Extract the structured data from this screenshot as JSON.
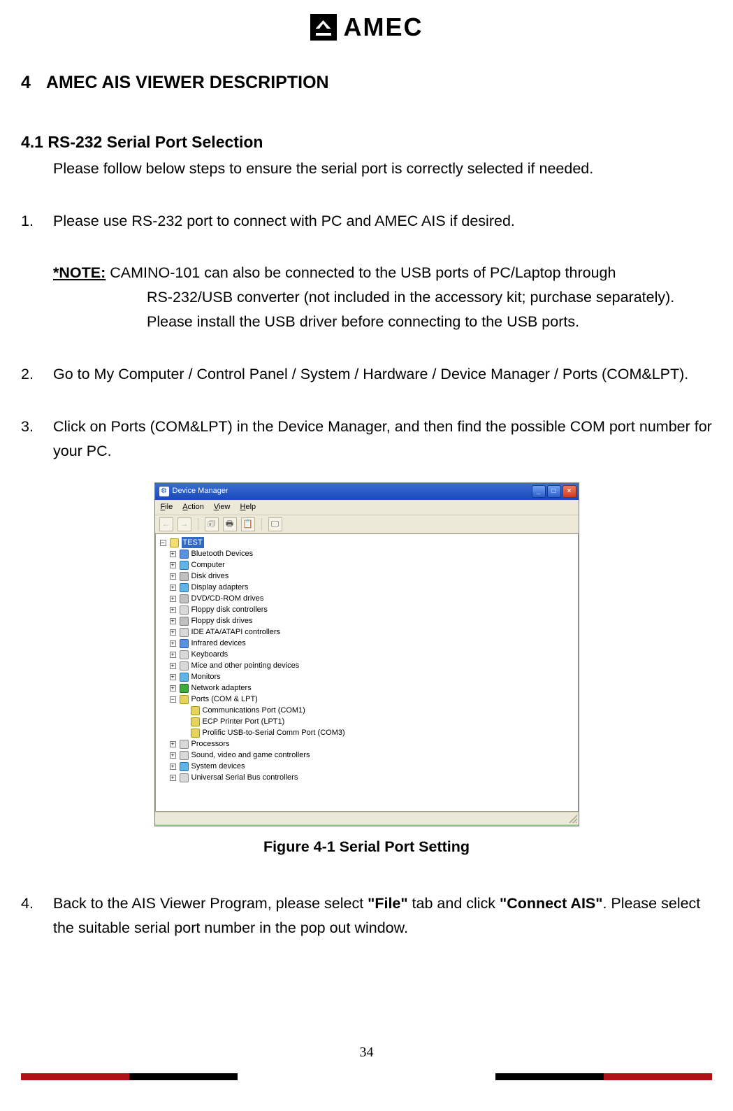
{
  "brand": "AMEC",
  "section_num": "4",
  "section_title": "AMEC AIS VIEWER DESCRIPTION",
  "subsection": "4.1 RS-232 Serial Port Selection",
  "intro": "Please follow below steps to ensure the serial port is correctly selected if needed.",
  "steps": {
    "n1": "1.",
    "s1": "Please use RS-232 port to connect with PC and AMEC AIS if desired.",
    "note_label": "*NOTE:",
    "note_l1": " CAMINO-101 can also be connected to the USB ports of PC/Laptop through",
    "note_l2": "RS-232/USB converter (not included in the accessory kit; purchase separately).",
    "note_l3": "Please install the USB driver before connecting to the USB ports.",
    "n2": "2.",
    "s2": "Go to My Computer / Control Panel / System / Hardware / Device Manager / Ports (COM&LPT).",
    "n3": "3.",
    "s3": "Click on Ports (COM&LPT) in the Device Manager, and then find the possible COM port number for your PC.",
    "n4": "4.",
    "s4a": "Back to the AIS Viewer Program, please select ",
    "s4b": "\"File\"",
    "s4c": " tab and click ",
    "s4d": "\"Connect AIS\"",
    "s4e": ". Please select the suitable serial port number in the pop out window."
  },
  "figure_caption": "Figure 4-1 Serial Port Setting",
  "page_number": "34",
  "devmgr": {
    "title": "Device Manager",
    "menus": [
      "File",
      "Action",
      "View",
      "Help"
    ],
    "root": "TEST",
    "items": [
      {
        "label": "Bluetooth Devices",
        "icon": "blue"
      },
      {
        "label": "Computer",
        "icon": "mon"
      },
      {
        "label": "Disk drives",
        "icon": "gray"
      },
      {
        "label": "Display adapters",
        "icon": "mon"
      },
      {
        "label": "DVD/CD-ROM drives",
        "icon": "gray"
      },
      {
        "label": "Floppy disk controllers",
        "icon": "dev"
      },
      {
        "label": "Floppy disk drives",
        "icon": "gray"
      },
      {
        "label": "IDE ATA/ATAPI controllers",
        "icon": "dev"
      },
      {
        "label": "Infrared devices",
        "icon": "blue"
      },
      {
        "label": "Keyboards",
        "icon": "dev"
      },
      {
        "label": "Mice and other pointing devices",
        "icon": "dev"
      },
      {
        "label": "Monitors",
        "icon": "mon"
      },
      {
        "label": "Network adapters",
        "icon": "green"
      },
      {
        "label": "Ports (COM & LPT)",
        "icon": "yel",
        "expanded": true,
        "children": [
          "Communications Port (COM1)",
          "ECP Printer Port (LPT1)",
          "Prolific USB-to-Serial Comm Port (COM3)"
        ]
      },
      {
        "label": "Processors",
        "icon": "dev"
      },
      {
        "label": "Sound, video and game controllers",
        "icon": "dev"
      },
      {
        "label": "System devices",
        "icon": "mon"
      },
      {
        "label": "Universal Serial Bus controllers",
        "icon": "dev"
      }
    ]
  }
}
